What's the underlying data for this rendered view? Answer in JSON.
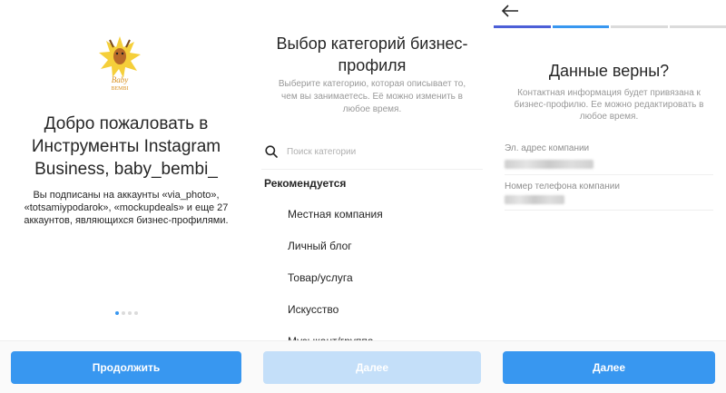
{
  "welcome_screen": {
    "logo_text": "Baby BEMBI",
    "title": "Добро пожаловать в Инструменты Instagram Business, baby_bembi_",
    "description": "Вы подписаны на аккаунты «via_photo», «totsamiypodarok», «mockupdeals» и еще 27 аккаунтов, являющихся бизнес-профилями.",
    "page_dots": {
      "count": 4,
      "active": 0
    },
    "continue_label": "Продолжить"
  },
  "category_screen": {
    "title": "Выбор категорий бизнес-профиля",
    "description": "Выберите категорию, которая описывает то, чем вы занимаетесь. Её можно изменить в любое время.",
    "search_placeholder": "Поиск категории",
    "recommended_heading": "Рекомендуется",
    "categories": [
      "Местная компания",
      "Личный блог",
      "Товар/услуга",
      "Искусство",
      "Музыкант/группа"
    ],
    "next_label": "Далее"
  },
  "contact_screen": {
    "title": "Данные верны?",
    "description": "Контактная информация будет привязана к бизнес-профилю. Ее можно редактировать в любое время.",
    "email_label": "Эл. адрес компании",
    "phone_label": "Номер телефона компании",
    "next_label": "Далее"
  },
  "colors": {
    "accent": "#3897f0",
    "accent_disabled": "#c4dff9",
    "progress_start": "#4c5fd7"
  },
  "icons": [
    "search-icon",
    "back-arrow-icon"
  ]
}
